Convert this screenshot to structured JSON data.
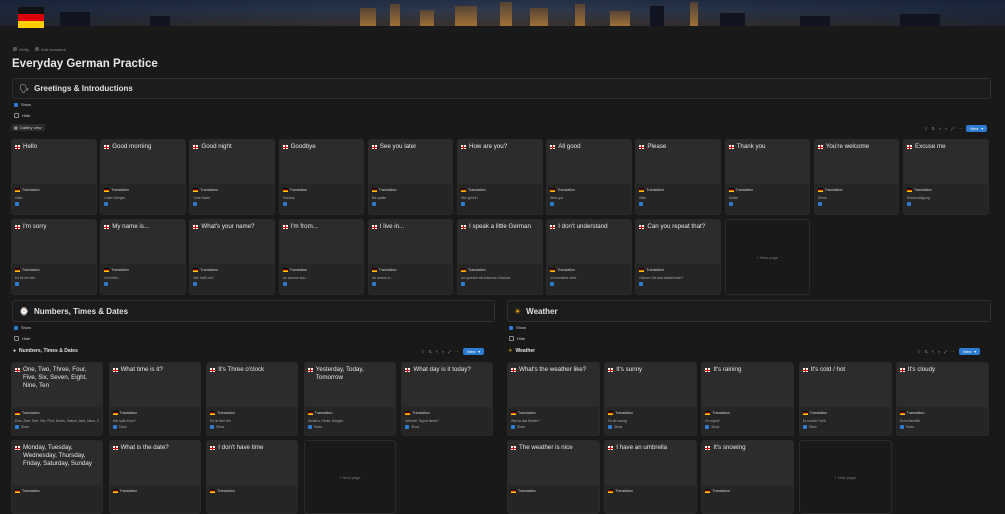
{
  "breadcrumb": {
    "items": [
      "Verify",
      "Add comment"
    ]
  },
  "page": {
    "title": "Everyday German Practice"
  },
  "toggle": {
    "show": "Show",
    "hide": "Hide"
  },
  "views": {
    "gallery": "Gallery view",
    "new": "New"
  },
  "greetings": {
    "heading": "Greetings & Introductions",
    "icon": "🗣",
    "cards": [
      {
        "title": "Hello",
        "prop": "Translation",
        "value": "Hallo",
        "checked": true
      },
      {
        "title": "Good morning",
        "prop": "Translation",
        "value": "Guten Morgen",
        "checked": true
      },
      {
        "title": "Good night",
        "prop": "Translation",
        "value": "Gute Nacht",
        "checked": true
      },
      {
        "title": "Goodbye",
        "prop": "Translation",
        "value": "Tschüss",
        "checked": true
      },
      {
        "title": "See you later",
        "prop": "Translation",
        "value": "Bis später",
        "checked": true
      },
      {
        "title": "How are you?",
        "prop": "Translation",
        "value": "Wie geht's?",
        "checked": true
      },
      {
        "title": "All good",
        "prop": "Translation",
        "value": "Alles gut",
        "checked": true
      },
      {
        "title": "Please",
        "prop": "Translation",
        "value": "Bitte",
        "checked": true
      },
      {
        "title": "Thank you",
        "prop": "Translation",
        "value": "Danke",
        "checked": true
      },
      {
        "title": "You're welcome",
        "prop": "Translation",
        "value": "Gerne",
        "checked": true
      },
      {
        "title": "Excuse me",
        "prop": "Translation",
        "value": "Entschuldigung",
        "checked": true
      },
      {
        "title": "I'm sorry",
        "prop": "Translation",
        "value": "Es tut mir leid",
        "checked": true
      },
      {
        "title": "My name is...",
        "prop": "Translation",
        "value": "Ich heiße...",
        "checked": true
      },
      {
        "title": "What's your name?",
        "prop": "Translation",
        "value": "Wie heißt du?",
        "checked": true
      },
      {
        "title": "I'm from...",
        "prop": "Translation",
        "value": "Ich komme aus...",
        "checked": true
      },
      {
        "title": "I live in...",
        "prop": "Translation",
        "value": "Ich wohne in...",
        "checked": true
      },
      {
        "title": "I speak a little German",
        "prop": "Translation",
        "value": "Ich spreche ein bisschen Deutsch",
        "checked": true
      },
      {
        "title": "I don't understand",
        "prop": "Translation",
        "value": "Ich verstehe nicht",
        "checked": true
      },
      {
        "title": "Can you repeat that?",
        "prop": "Translation",
        "value": "Können Sie das wiederholen?",
        "checked": true
      }
    ],
    "new_page": "New page"
  },
  "numbers": {
    "heading": "Numbers, Times & Dates",
    "icon": "⌚",
    "view_label": "Numbers, Times & Dates",
    "cards": [
      {
        "title": "One, Two, Three, Four, Five, Six, Seven, Eight, Nine, Ten",
        "prop": "Translation",
        "value": "Eins, Zwei, Drei, Vier, Fünf, Sechs, Sieben, Acht, Neun, Zehn",
        "show": "Show"
      },
      {
        "title": "What time is it?",
        "prop": "Translation",
        "value": "Wie spät ist es?",
        "show": "Show"
      },
      {
        "title": "It's Three o'clock",
        "prop": "Translation",
        "value": "Es ist drei Uhr",
        "show": "Show"
      },
      {
        "title": "Yesterday, Today, Tomorrow",
        "prop": "Translation",
        "value": "Gestern, Heute, Morgen",
        "show": "Show"
      },
      {
        "title": "What day is it today?",
        "prop": "Translation",
        "value": "Welcher Tag ist heute?",
        "show": "Show"
      },
      {
        "title": "Monday, Tuesday, Wednesday, Thursday, Friday, Saturday, Sunday",
        "prop": "Translation",
        "value": "",
        "show": ""
      },
      {
        "title": "What is the date?",
        "prop": "Translation",
        "value": "",
        "show": ""
      },
      {
        "title": "I don't have time",
        "prop": "Translation",
        "value": "",
        "show": ""
      }
    ],
    "new_page": "New page"
  },
  "weather": {
    "heading": "Weather",
    "icon": "☀",
    "view_label": "Weather",
    "cards": [
      {
        "title": "What's the weather like?",
        "prop": "Translation",
        "value": "Wie ist das Wetter?",
        "show": "Show"
      },
      {
        "title": "It's sunny",
        "prop": "Translation",
        "value": "Es ist sonnig",
        "show": "Show"
      },
      {
        "title": "It's raining",
        "prop": "Translation",
        "value": "Es regnet",
        "show": "Show"
      },
      {
        "title": "It's cold / hot",
        "prop": "Translation",
        "value": "Es ist kalt / heiß",
        "show": "Show"
      },
      {
        "title": "It's cloudy",
        "prop": "Translation",
        "value": "Es ist bewölkt",
        "show": "Show"
      },
      {
        "title": "The weather is nice",
        "prop": "Translation",
        "value": "",
        "show": ""
      },
      {
        "title": "I have an umbrella",
        "prop": "Translation",
        "value": "",
        "show": ""
      },
      {
        "title": "It's snowing",
        "prop": "Translation",
        "value": "",
        "show": ""
      }
    ],
    "new_page": "New page"
  }
}
